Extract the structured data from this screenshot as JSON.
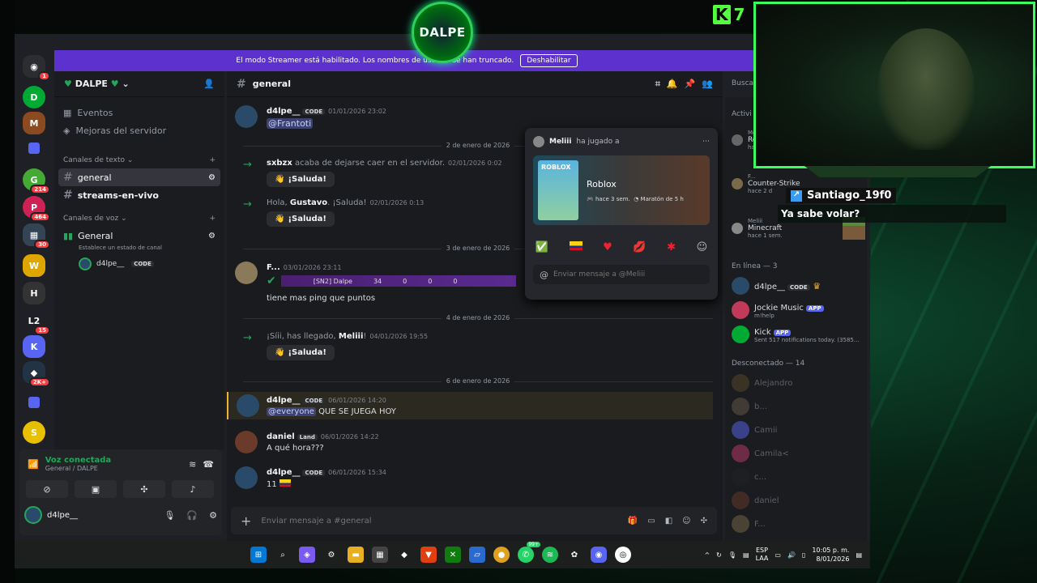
{
  "overlay": {
    "logo": "DALPE",
    "kick_label": "K",
    "kick_count": "7"
  },
  "banner": {
    "text": "El modo Streamer está habilitado. Los nombres de usuario se han truncado.",
    "button": "Deshabilitar"
  },
  "guilds": [
    {
      "badge": "1"
    },
    {
      "badge": ""
    },
    {
      "badge": ""
    },
    {
      "badge": "214"
    },
    {
      "badge": "464"
    },
    {
      "badge": "30"
    },
    {
      "badge": ""
    },
    {
      "badge": ""
    },
    {
      "badge": "15"
    },
    {
      "badge": ""
    },
    {
      "badge": "2K+"
    },
    {
      "badge": ""
    },
    {
      "badge": ""
    }
  ],
  "server": {
    "name": "DALPE",
    "events": "Eventos",
    "boost": "Mejoras del servidor",
    "text_category": "Canales de texto",
    "text_channels": [
      "general",
      "streams-en-vivo"
    ],
    "voice_category": "Canales de voz",
    "voice_channel": "General",
    "voice_status": "Establece un estado de canal",
    "voice_user": "d4lpe__",
    "voice_user_tag": "CODE"
  },
  "voice": {
    "status": "Voz conectada",
    "location": "General / DALPE"
  },
  "user": {
    "name": "d4lpe__"
  },
  "channel": {
    "name": "general",
    "search": "Buscar",
    "composer_placeholder": "Enviar mensaje a #general"
  },
  "messages": {
    "m1": {
      "user": "d4lpe__",
      "tag": "CODE",
      "time": "01/01/2026 23:02",
      "text": "@Frantoti"
    },
    "d1": "2 de enero de 2026",
    "j1": {
      "user": "sxbzx",
      "text": "acaba de dejarse caer en el servidor.",
      "time": "02/01/2026 0:02",
      "wave": "¡Saluda!"
    },
    "j2": {
      "pre": "Hola,",
      "user": "Gustavo",
      "post": ". ¡Saluda!",
      "time": "02/01/2026 0:13",
      "wave": "¡Saluda!"
    },
    "d2": "3 de enero de 2026",
    "m2": {
      "user": "F...",
      "time": "03/01/2026 23:11",
      "embed": "[SN2] Dalpe",
      "embed_n1": "34",
      "embed_n2": "0",
      "embed_n3": "0",
      "embed_n4": "0",
      "text": "tiene mas ping que puntos"
    },
    "d3": "4 de enero de 2026",
    "j3": {
      "pre": "¡Síii, has llegado,",
      "user": "Meliii",
      "post": "!",
      "time": "04/01/2026 19:55",
      "wave": "¡Saluda!"
    },
    "d4": "6 de enero de 2026",
    "m3": {
      "user": "d4lpe__",
      "tag": "CODE",
      "time": "06/01/2026 14:20",
      "mention": "@everyone",
      "text": "QUE SE JUEGA HOY"
    },
    "m4": {
      "user": "daniel",
      "tag": "Land",
      "time": "06/01/2026 14:22",
      "text": "A qué hora???"
    },
    "m5": {
      "user": "d4lpe__",
      "tag": "CODE",
      "time": "06/01/2026 15:34",
      "text": "11"
    }
  },
  "popup": {
    "user": "Meliii",
    "action": "ha jugado a",
    "game": "Roblox",
    "meta1": "hace 3 sem.",
    "meta2": "Maratón de 5 h",
    "placeholder": "Enviar mensaje a @Meliii",
    "thumb": "ROBLOX"
  },
  "members": {
    "activity_title": "Activi",
    "activities": [
      {
        "user": "Me...",
        "game": "Roblox",
        "time": "hace..."
      },
      {
        "user": "F...",
        "game": "Counter-Strike",
        "time": "hace 2 d"
      },
      {
        "user": "Meliii",
        "game": "Minecraft",
        "time": "hace 1 sem."
      }
    ],
    "online_header": "En línea — 3",
    "online": [
      {
        "name": "d4lpe__",
        "tag": "CODE",
        "sub": ""
      },
      {
        "name": "Jockie Music",
        "tag": "APP",
        "sub": "m!help"
      },
      {
        "name": "Kick",
        "tag": "APP",
        "sub": "Sent 517 notifications today. (3585..."
      }
    ],
    "offline_header": "Desconectado — 14",
    "offline": [
      "Alejandro",
      "b...",
      "Camii",
      "Camila<",
      "c...",
      "daniel",
      "F..."
    ]
  },
  "chat_overlay": {
    "user": "Santiago_19f0",
    "message": "Ya sabe volar?"
  },
  "taskbar": {
    "lang1": "ESP",
    "lang2": "LAA",
    "time": "10:05 p. m.",
    "date": "8/01/2026",
    "whatsapp_badge": "99+"
  },
  "colors": {
    "accent": "#5865f2",
    "banner": "#5d31ce",
    "online": "#23a55a",
    "stream_green": "#3cff5a"
  }
}
